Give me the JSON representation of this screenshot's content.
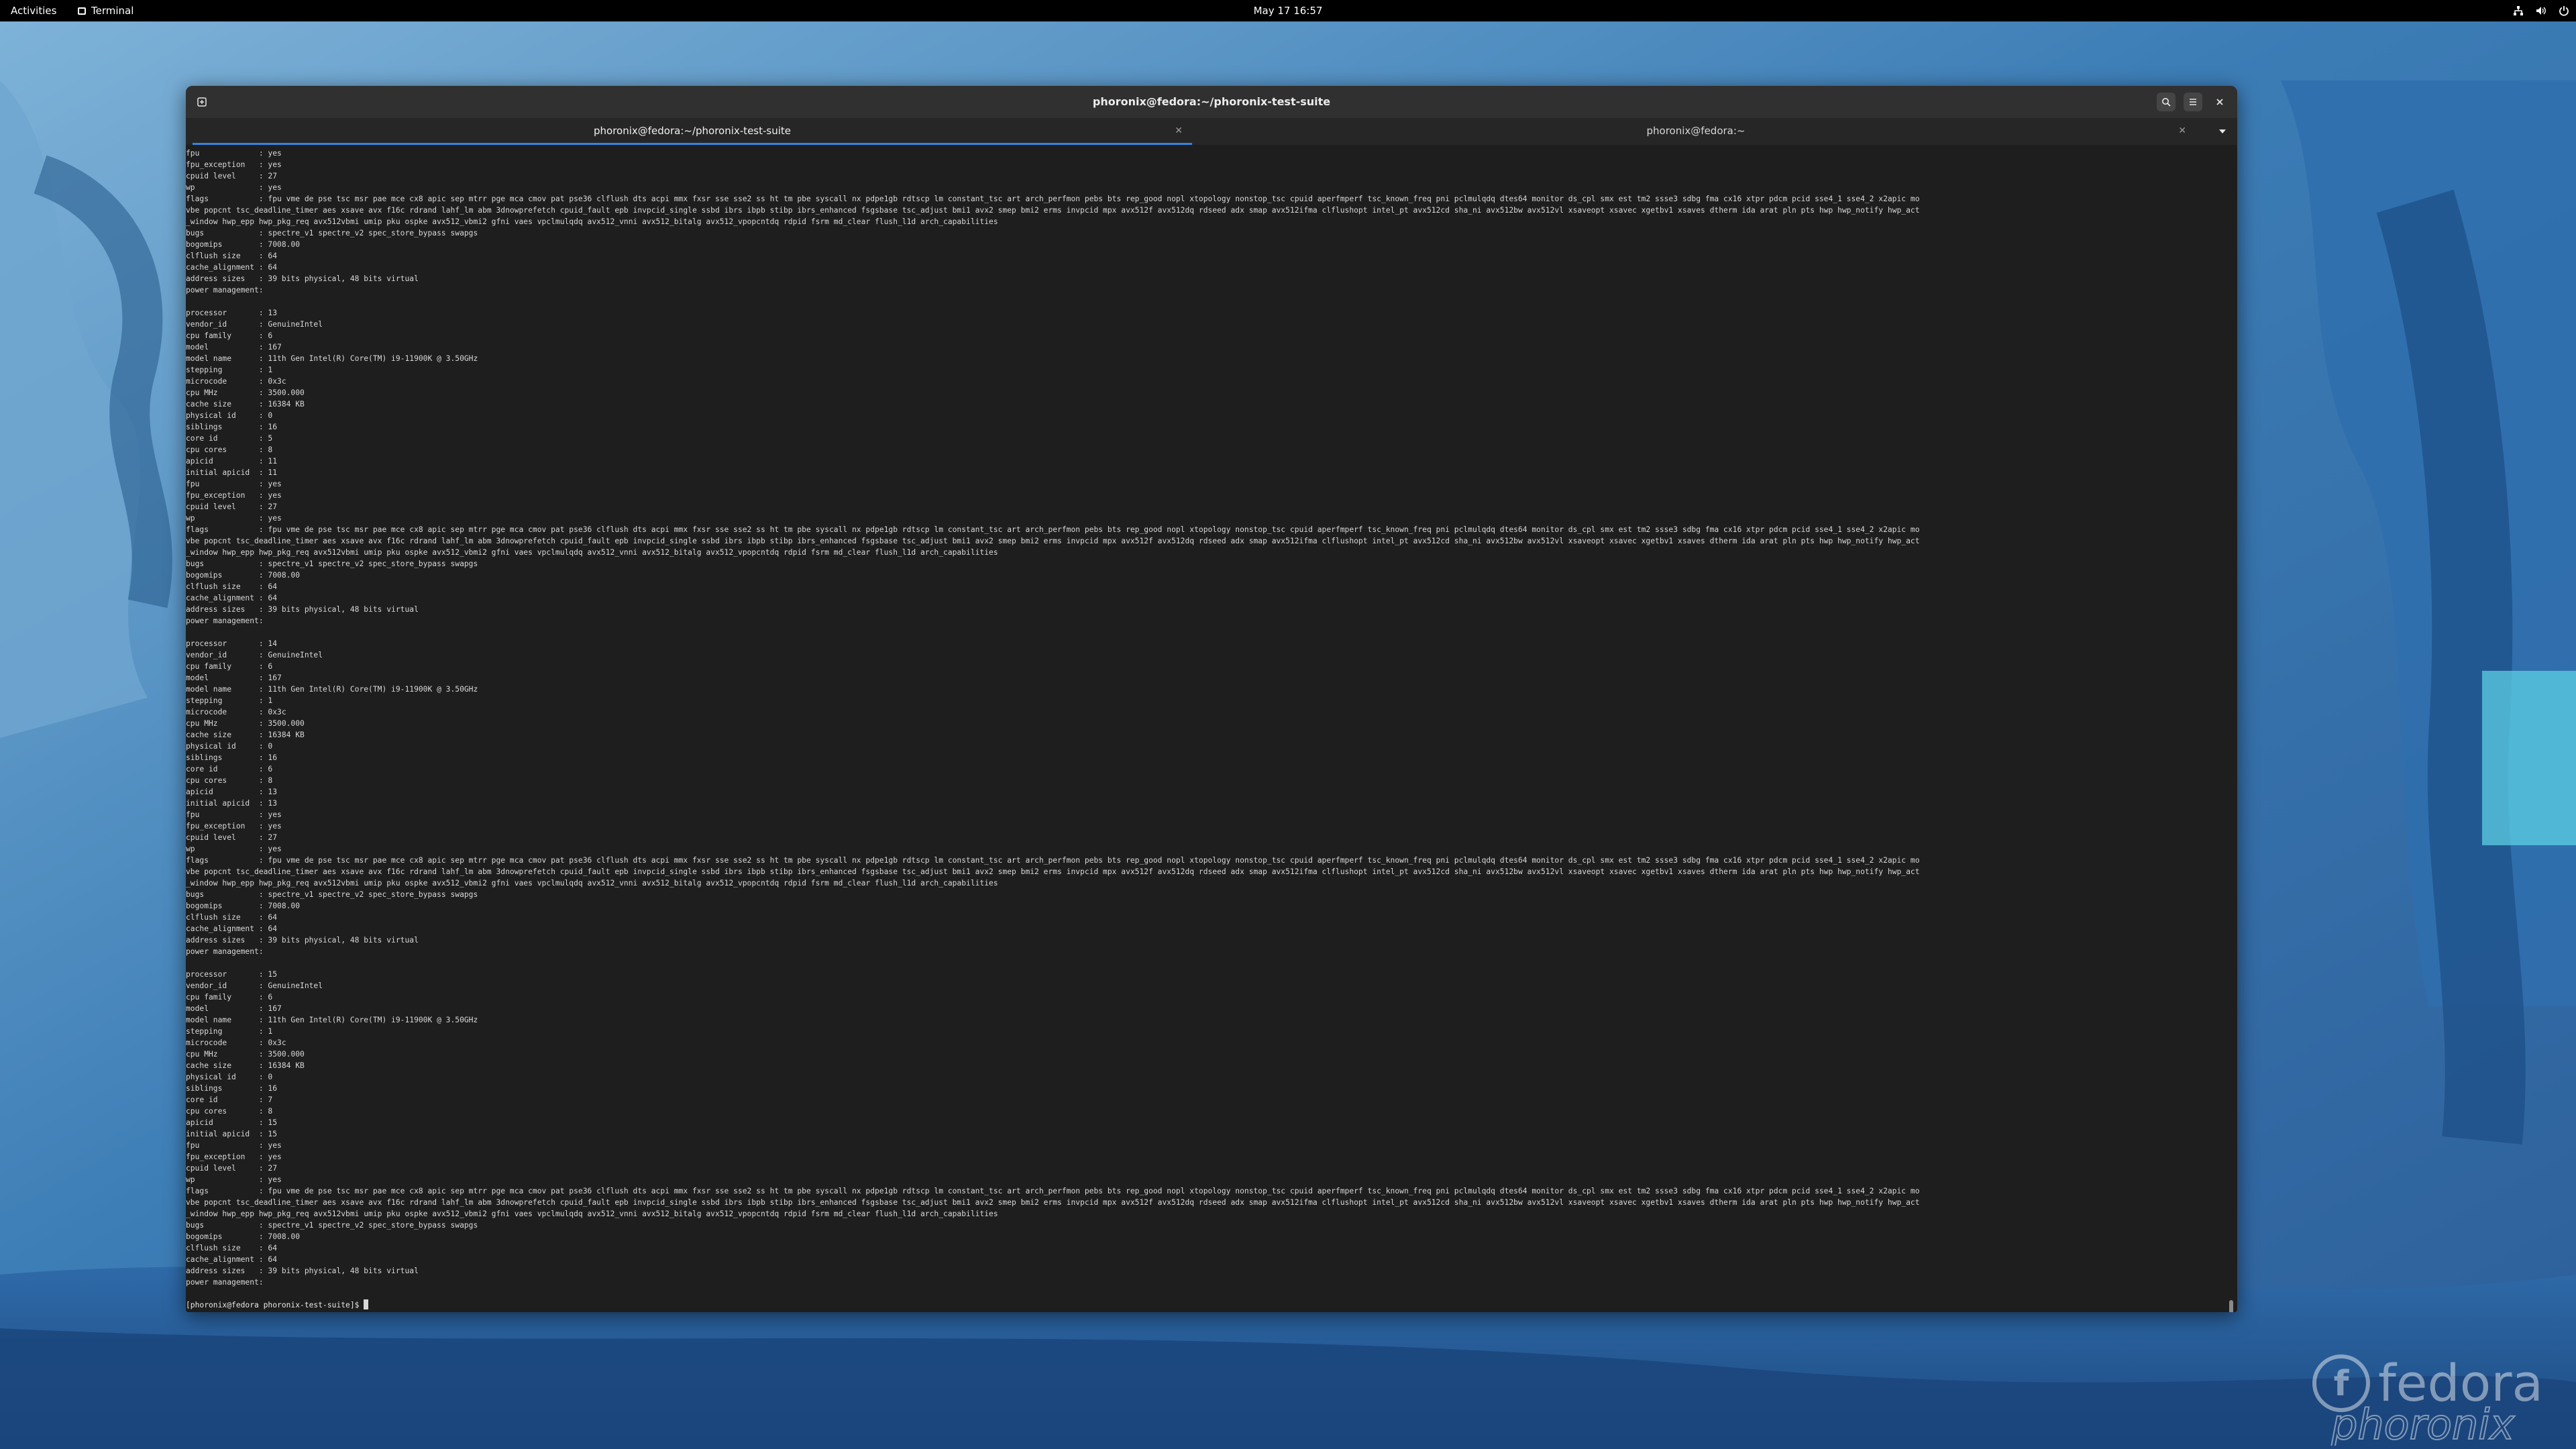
{
  "topbar": {
    "activities": "Activities",
    "app_name": "Terminal",
    "clock": "May 17  16:57",
    "tray_icons": [
      "network-icon",
      "volume-icon",
      "power-icon"
    ]
  },
  "window": {
    "title": "phoronix@fedora:~/phoronix-test-suite",
    "tabs": [
      {
        "label": "phoronix@fedora:~/phoronix-test-suite",
        "active": true
      },
      {
        "label": "phoronix@fedora:~",
        "active": false
      }
    ]
  },
  "terminal": {
    "lines_top": [
      "fpu             : yes",
      "fpu_exception   : yes",
      "cpuid level     : 27",
      "wp              : yes",
      "flags           : fpu vme de pse tsc msr pae mce cx8 apic sep mtrr pge mca cmov pat pse36 clflush dts acpi mmx fxsr sse sse2 ss ht tm pbe syscall nx pdpe1gb rdtscp lm constant_tsc art arch_perfmon pebs bts rep_good nopl xtopology nonstop_tsc cpuid aperfmperf tsc_known_freq pni pclmulqdq dtes64 monitor ds_cpl smx est tm2 ssse3 sdbg fma cx16 xtpr pdcm pcid sse4_1 sse4_2 x2apic mo",
      "vbe popcnt tsc_deadline_timer aes xsave avx f16c rdrand lahf_lm abm 3dnowprefetch cpuid_fault epb invpcid_single ssbd ibrs ibpb stibp ibrs_enhanced fsgsbase tsc_adjust bmi1 avx2 smep bmi2 erms invpcid mpx avx512f avx512dq rdseed adx smap avx512ifma clflushopt intel_pt avx512cd sha_ni avx512bw avx512vl xsaveopt xsavec xgetbv1 xsaves dtherm ida arat pln pts hwp hwp_notify hwp_act",
      "_window hwp_epp hwp_pkg_req avx512vbmi umip pku ospke avx512_vbmi2 gfni vaes vpclmulqdq avx512_vnni avx512_bitalg avx512_vpopcntdq rdpid fsrm md_clear flush_l1d arch_capabilities",
      "bugs            : spectre_v1 spectre_v2 spec_store_bypass swapgs",
      "bogomips        : 7008.00",
      "clflush size    : 64",
      "cache_alignment : 64",
      "address sizes   : 39 bits physical, 48 bits virtual",
      "power management:",
      ""
    ],
    "processors": [
      {
        "processor": "13",
        "core_id": "5",
        "apicid": "11",
        "initial_apicid": "11"
      },
      {
        "processor": "14",
        "core_id": "6",
        "apicid": "13",
        "initial_apicid": "13"
      },
      {
        "processor": "15",
        "core_id": "7",
        "apicid": "15",
        "initial_apicid": "15"
      }
    ],
    "common": {
      "vendor_id": "GenuineIntel",
      "cpu_family": "6",
      "model": "167",
      "model_name": "11th Gen Intel(R) Core(TM) i9-11900K @ 3.50GHz",
      "stepping": "1",
      "microcode": "0x3c",
      "cpu_mhz": "3500.000",
      "cache_size": "16384 KB",
      "physical_id": "0",
      "siblings": "16",
      "cpu_cores": "8",
      "fpu": "yes",
      "fpu_exception": "yes",
      "cpuid_level": "27",
      "wp": "yes",
      "flags_1": "fpu vme de pse tsc msr pae mce cx8 apic sep mtrr pge mca cmov pat pse36 clflush dts acpi mmx fxsr sse sse2 ss ht tm pbe syscall nx pdpe1gb rdtscp lm constant_tsc art arch_perfmon pebs bts rep_good nopl xtopology nonstop_tsc cpuid aperfmperf tsc_known_freq pni pclmulqdq dtes64 monitor ds_cpl smx est tm2 ssse3 sdbg fma cx16 xtpr pdcm pcid sse4_1 sse4_2 x2apic mo",
      "flags_2": "vbe popcnt tsc_deadline_timer aes xsave avx f16c rdrand lahf_lm abm 3dnowprefetch cpuid_fault epb invpcid_single ssbd ibrs ibpb stibp ibrs_enhanced fsgsbase tsc_adjust bmi1 avx2 smep bmi2 erms invpcid mpx avx512f avx512dq rdseed adx smap avx512ifma clflushopt intel_pt avx512cd sha_ni avx512bw avx512vl xsaveopt xsavec xgetbv1 xsaves dtherm ida arat pln pts hwp hwp_notify hwp_act",
      "flags_3": "_window hwp_epp hwp_pkg_req avx512vbmi umip pku ospke avx512_vbmi2 gfni vaes vpclmulqdq avx512_vnni avx512_bitalg avx512_vpopcntdq rdpid fsrm md_clear flush_l1d arch_capabilities",
      "bugs": "spectre_v1 spectre_v2 spec_store_bypass swapgs",
      "bogomips": "7008.00",
      "clflush_size": "64",
      "cache_alignment": "64",
      "address_sizes": "39 bits physical, 48 bits virtual"
    },
    "prompt": "[phoronix@fedora phoronix-test-suite]$ "
  },
  "watermark": {
    "line1": "fedora",
    "line2": "phoronix"
  },
  "colors": {
    "terminal_bg": "#1e1e1e",
    "headerbar_bg": "#303030",
    "accent": "#3584e4"
  }
}
